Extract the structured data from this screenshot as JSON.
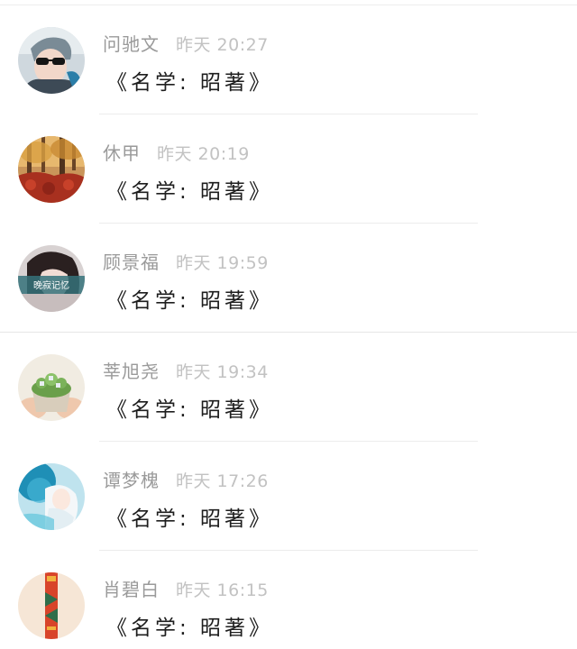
{
  "messages": [
    {
      "sender": "问驰文",
      "time": "昨天 20:27",
      "text": "《名学: 昭著》",
      "avatar_icon": "avatar-sunglasses-portrait"
    },
    {
      "sender": "休甲",
      "time": "昨天 20:19",
      "text": "《名学: 昭著》",
      "avatar_icon": "avatar-autumn-forest"
    },
    {
      "sender": "顾景福",
      "time": "昨天 19:59",
      "text": "《名学: 昭著》",
      "avatar_icon": "avatar-girl-portrait",
      "avatar_caption": "晚寂记忆"
    },
    {
      "sender": "莘旭尧",
      "time": "昨天 19:34",
      "text": "《名学: 昭著》",
      "avatar_icon": "avatar-potted-plant"
    },
    {
      "sender": "谭梦槐",
      "time": "昨天 17:26",
      "text": "《名学: 昭著》",
      "avatar_icon": "avatar-blue-anime"
    },
    {
      "sender": "肖碧白",
      "time": "昨天 16:15",
      "text": "《名学: 昭著》",
      "avatar_icon": "avatar-red-pattern"
    }
  ],
  "colors": {
    "sender": "#9a9a9a",
    "time": "#c2c2c2",
    "text": "#1e1e1e",
    "divider": "#ececec"
  }
}
